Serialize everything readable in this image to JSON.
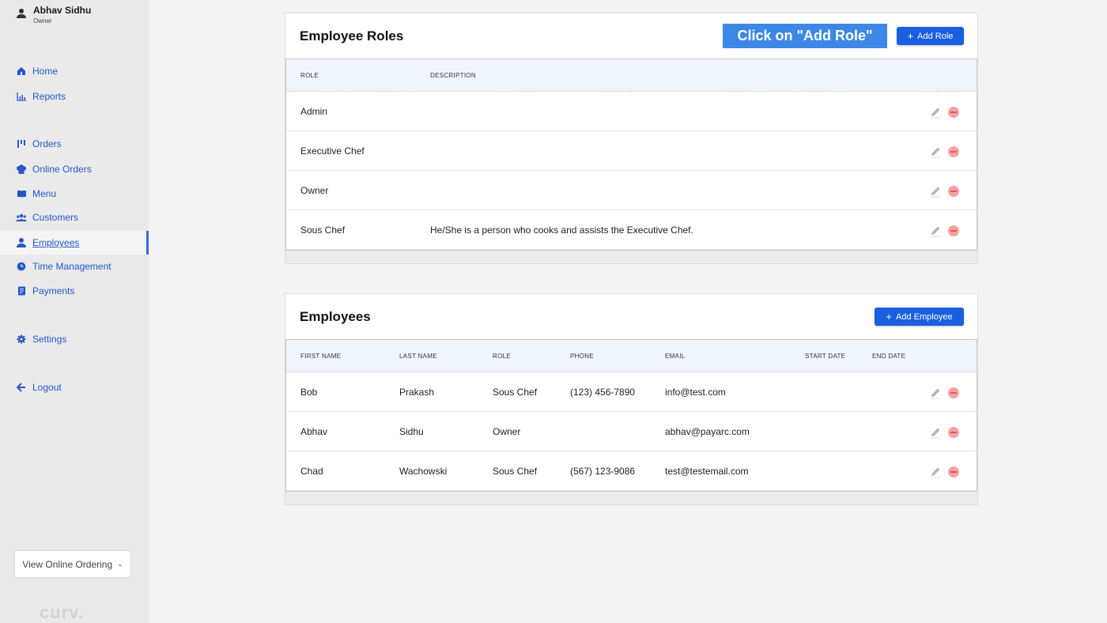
{
  "user": {
    "name": "Abhav Sidhu",
    "role": "Owner",
    "icon": "person-icon"
  },
  "nav": [
    {
      "label": "Home",
      "icon": "home-icon"
    },
    {
      "label": "Reports",
      "icon": "chart-icon"
    },
    {
      "label": "Orders",
      "icon": "orders-icon"
    },
    {
      "label": "Online Orders",
      "icon": "chef-hat-icon"
    },
    {
      "label": "Menu",
      "icon": "book-icon"
    },
    {
      "label": "Customers",
      "icon": "people-icon"
    },
    {
      "label": "Employees",
      "icon": "person-icon",
      "active": true
    },
    {
      "label": "Time Management",
      "icon": "clock-icon"
    },
    {
      "label": "Payments",
      "icon": "document-icon"
    },
    {
      "label": "Settings",
      "icon": "gear-icon"
    },
    {
      "label": "Logout",
      "icon": "arrow-left-icon"
    }
  ],
  "view_online_ordering": "View Online Ordering",
  "brand": "curv.",
  "roles_card": {
    "title": "Employee Roles",
    "callout": "Click on \"Add Role\"",
    "add_button": "Add Role",
    "headers": {
      "role": "ROLE",
      "description": "DESCRIPTION"
    },
    "rows": [
      {
        "role": "Admin",
        "description": ""
      },
      {
        "role": "Executive Chef",
        "description": ""
      },
      {
        "role": "Owner",
        "description": ""
      },
      {
        "role": "Sous Chef",
        "description": "He/She is a person who cooks and assists the Executive Chef."
      }
    ]
  },
  "employees_card": {
    "title": "Employees",
    "add_button": "Add Employee",
    "headers": {
      "first_name": "FIRST NAME",
      "last_name": "LAST NAME",
      "role": "ROLE",
      "phone": "PHONE",
      "email": "EMAIL",
      "start_date": "START DATE",
      "end_date": "END DATE"
    },
    "rows": [
      {
        "first_name": "Bob",
        "last_name": "Prakash",
        "role": "Sous Chef",
        "phone": "(123) 456-7890",
        "email": "info@test.com",
        "start_date": "",
        "end_date": ""
      },
      {
        "first_name": "Abhav",
        "last_name": "Sidhu",
        "role": "Owner",
        "phone": "",
        "email": "abhav@payarc.com",
        "start_date": "",
        "end_date": ""
      },
      {
        "first_name": "Chad",
        "last_name": "Wachowski",
        "role": "Sous Chef",
        "phone": "(567) 123-9086",
        "email": "test@testemail.com",
        "start_date": "",
        "end_date": ""
      }
    ]
  },
  "colors": {
    "accent": "#1a5fe0",
    "nav_text": "#2556c9",
    "callout": "#3d88e6",
    "delete": "#e35555"
  }
}
